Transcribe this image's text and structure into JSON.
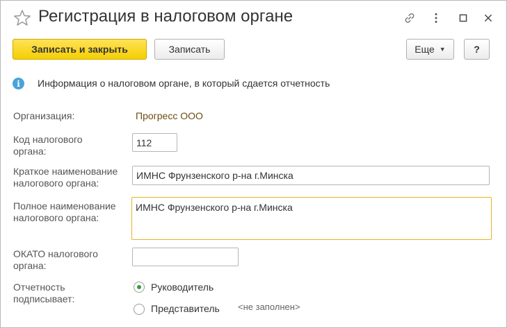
{
  "window": {
    "title": "Регистрация в налоговом органе",
    "icons": [
      "star-icon",
      "link-icon",
      "more-vertical-icon",
      "maximize-icon",
      "close-icon"
    ]
  },
  "toolbar": {
    "save_close_label": "Записать и закрыть",
    "save_label": "Записать",
    "more_label": "Еще",
    "help_label": "?"
  },
  "info": {
    "icon": "info-icon",
    "text": "Информация о налоговом органе, в который сдается отчетность"
  },
  "form": {
    "organization_label": "Организация:",
    "organization_value": "Прогресс ООО",
    "tax_code_label": "Код налогового органа:",
    "tax_code_value": "112",
    "short_name_label": "Краткое наименование налогового органа:",
    "short_name_value": "ИМНС Фрунзенского р-на г.Минска",
    "full_name_label": "Полное наименование налогового органа:",
    "full_name_value": "ИМНС Фрунзенского р-на г.Минска",
    "okato_label": "ОКАТО налогового органа:",
    "okato_value": "",
    "signer_label": "Отчетность подписывает:",
    "signer_options": [
      {
        "label": "Руководитель",
        "selected": true
      },
      {
        "label": "Представитель",
        "selected": false
      }
    ],
    "representative_hint": "<не заполнен>"
  },
  "colors": {
    "primary_button": "#f5cf00",
    "focused_border": "#e6b325",
    "link_text": "#6b4c12",
    "info_icon": "#4aa3d9",
    "radio_selected": "#3a9a3a"
  }
}
